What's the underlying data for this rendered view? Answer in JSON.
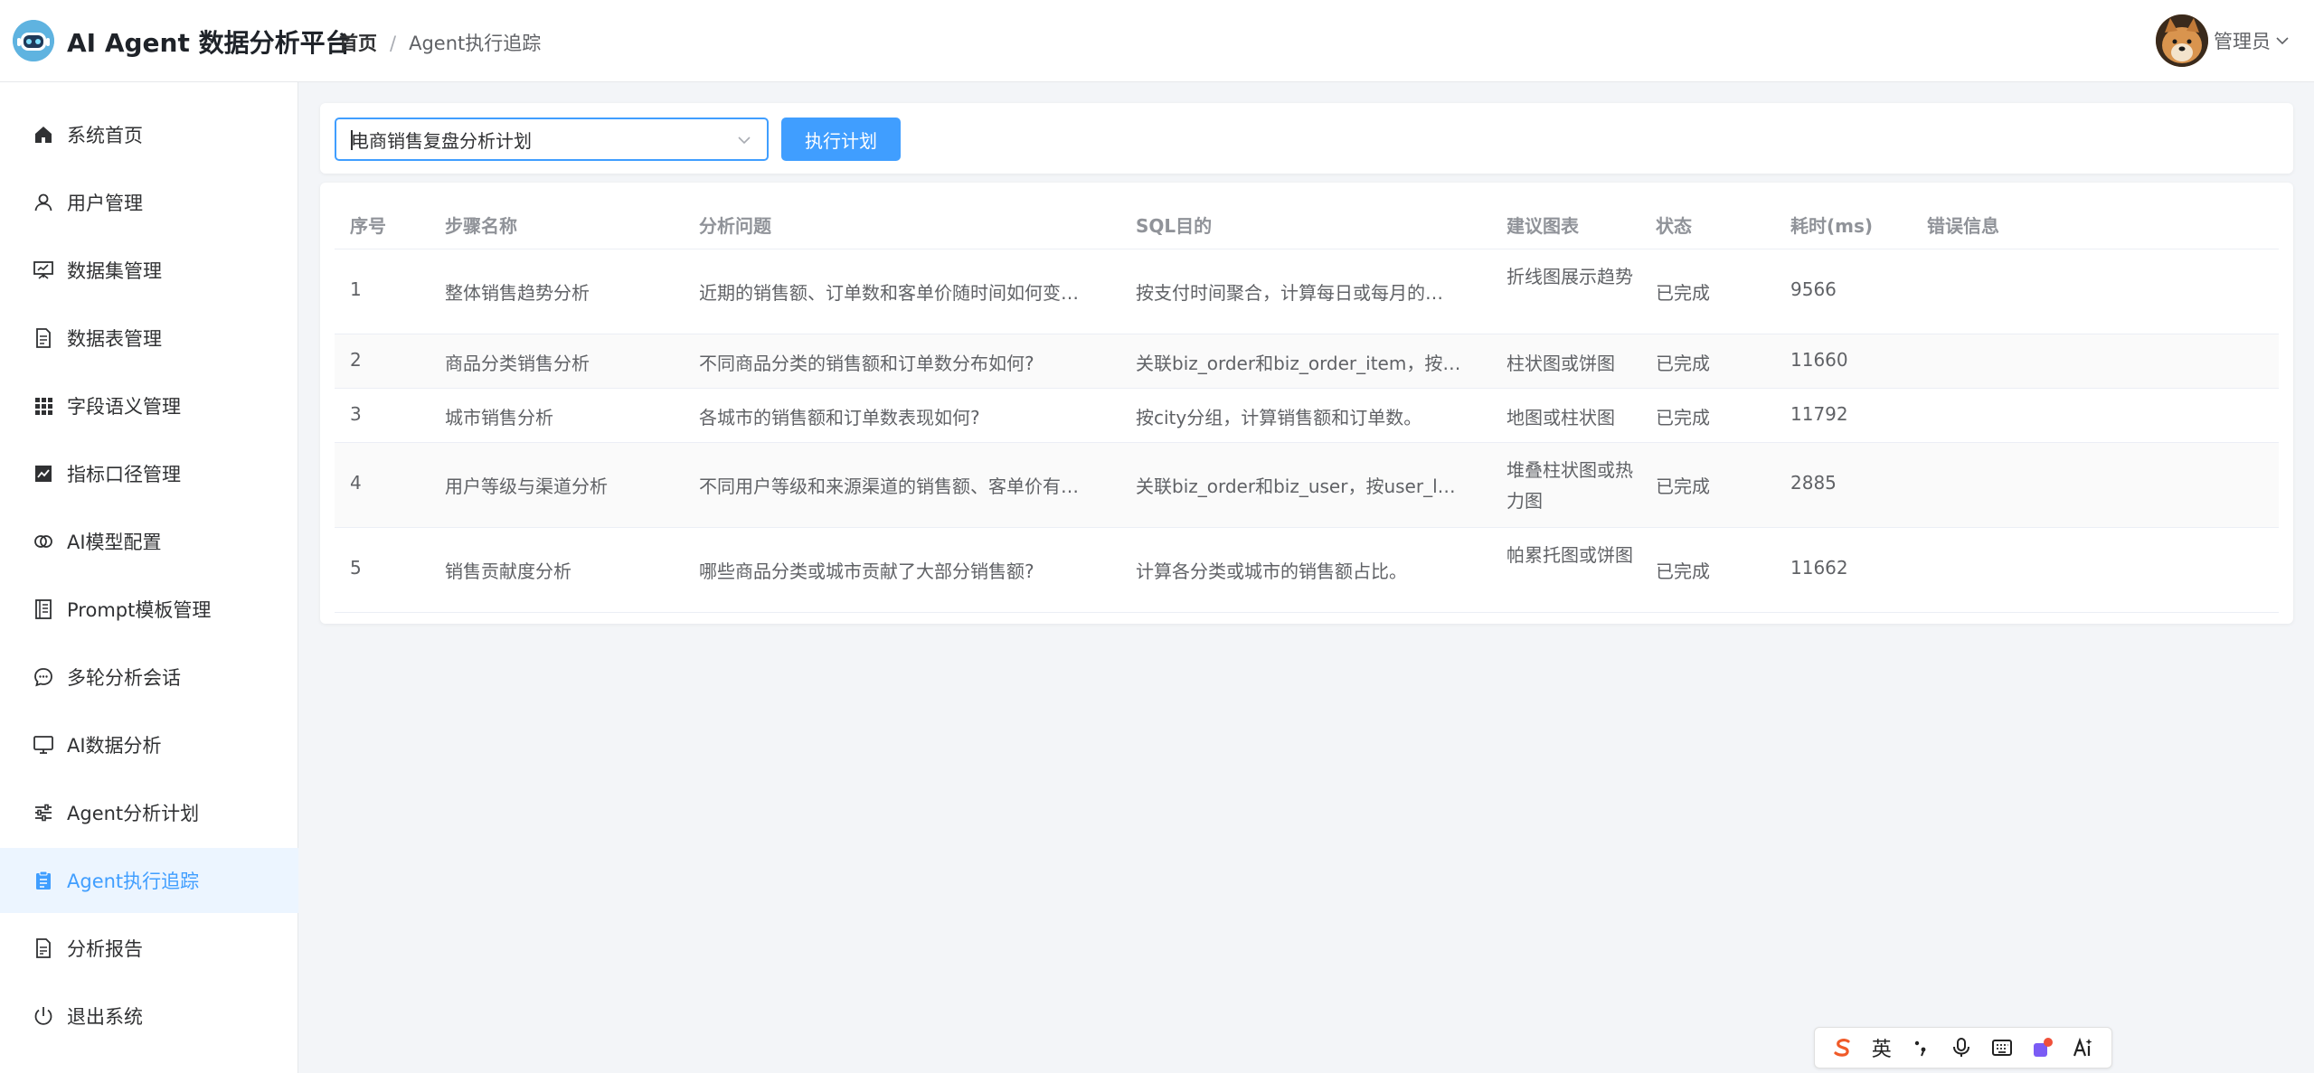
{
  "header": {
    "app_title": "AI Agent 数据分析平台",
    "breadcrumb_home": "首页",
    "breadcrumb_sep": "/",
    "breadcrumb_current": "Agent执行追踪",
    "user_name": "管理员"
  },
  "sidebar": {
    "items": [
      {
        "label": "系统首页",
        "icon": "home-icon"
      },
      {
        "label": "用户管理",
        "icon": "user-icon"
      },
      {
        "label": "数据集管理",
        "icon": "presentation-icon"
      },
      {
        "label": "数据表管理",
        "icon": "document-icon"
      },
      {
        "label": "字段语义管理",
        "icon": "grid-icon"
      },
      {
        "label": "指标口径管理",
        "icon": "chart-icon"
      },
      {
        "label": "AI模型配置",
        "icon": "link-icon"
      },
      {
        "label": "Prompt模板管理",
        "icon": "notebook-icon"
      },
      {
        "label": "多轮分析会话",
        "icon": "chat-icon"
      },
      {
        "label": "AI数据分析",
        "icon": "monitor-icon"
      },
      {
        "label": "Agent分析计划",
        "icon": "sliders-icon"
      },
      {
        "label": "Agent执行追踪",
        "icon": "clipboard-icon",
        "active": true
      },
      {
        "label": "分析报告",
        "icon": "report-icon"
      },
      {
        "label": "退出系统",
        "icon": "power-icon"
      }
    ]
  },
  "toolbar": {
    "plan_select_value": "电商销售复盘分析计划",
    "run_button_label": "执行计划"
  },
  "table": {
    "headers": [
      "序号",
      "步骤名称",
      "分析问题",
      "SQL目的",
      "建议图表",
      "状态",
      "耗时(ms)",
      "错误信息"
    ],
    "rows": [
      {
        "no": "1",
        "step": "整体销售趋势分析",
        "question": "近期的销售额、订单数和客单价随时间如何变…",
        "sql": "按支付时间聚合，计算每日或每月的…",
        "chart": "折线图展示趋势",
        "status": "已完成",
        "time": "9566",
        "error": ""
      },
      {
        "no": "2",
        "step": "商品分类销售分析",
        "question": "不同商品分类的销售额和订单数分布如何?",
        "sql": "关联biz_order和biz_order_item，按…",
        "chart": "柱状图或饼图",
        "status": "已完成",
        "time": "11660",
        "error": ""
      },
      {
        "no": "3",
        "step": "城市销售分析",
        "question": "各城市的销售额和订单数表现如何?",
        "sql": "按city分组，计算销售额和订单数。",
        "chart": "地图或柱状图",
        "status": "已完成",
        "time": "11792",
        "error": ""
      },
      {
        "no": "4",
        "step": "用户等级与渠道分析",
        "question": "不同用户等级和来源渠道的销售额、客单价有…",
        "sql": "关联biz_order和biz_user，按user_l…",
        "chart": "堆叠柱状图或热力图",
        "status": "已完成",
        "time": "2885",
        "error": ""
      },
      {
        "no": "5",
        "step": "销售贡献度分析",
        "question": "哪些商品分类或城市贡献了大部分销售额?",
        "sql": "计算各分类或城市的销售额占比。",
        "chart": "帕累托图或饼图",
        "status": "已完成",
        "time": "11662",
        "error": ""
      }
    ]
  },
  "ime": {
    "lang": "英"
  }
}
